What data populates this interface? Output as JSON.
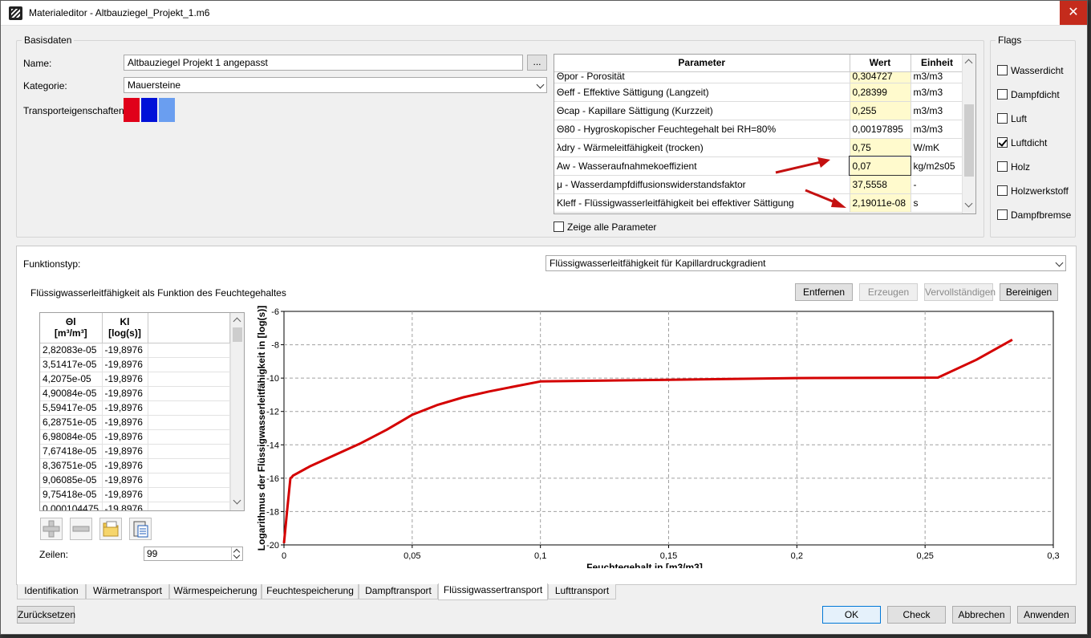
{
  "window": {
    "title": "Materialeditor - Altbauziegel_Projekt_1.m6",
    "close_label": "✕"
  },
  "basisdaten": {
    "group_title": "Basisdaten",
    "name_label": "Name:",
    "name_value": "Altbauziegel Projekt 1 angepasst",
    "browse_label": "...",
    "kategorie_label": "Kategorie:",
    "kategorie_value": "Mauersteine",
    "transport_label": "Transporteigenschaften:",
    "transport_colors": [
      "#e0001a",
      "#0010d8",
      "#6a9ef0"
    ]
  },
  "parameters": {
    "headers": [
      "Parameter",
      "Wert",
      "Einheit"
    ],
    "rows": [
      {
        "name": "Θpor - Porosität",
        "value": "0,304727",
        "unit": "m3/m3",
        "highlight": true
      },
      {
        "name": "Θeff - Effektive Sättigung (Langzeit)",
        "value": "0,28399",
        "unit": "m3/m3",
        "highlight": true
      },
      {
        "name": "Θcap - Kapillare Sättigung (Kurzzeit)",
        "value": "0,255",
        "unit": "m3/m3",
        "highlight": true
      },
      {
        "name": "Θ80 - Hygroskopischer Feuchtegehalt bei RH=80%",
        "value": "0,00197895",
        "unit": "m3/m3",
        "highlight": false
      },
      {
        "name": "λdry - Wärmeleitfähigkeit (trocken)",
        "value": "0,75",
        "unit": "W/mK",
        "highlight": true
      },
      {
        "name": "Aw - Wasseraufnahmekoeffizient",
        "value": "0,07",
        "unit": "kg/m2s05",
        "highlight": true
      },
      {
        "name": "μ - Wasserdampfdiffusionswiderstandsfaktor",
        "value": "37,5558",
        "unit": "-",
        "highlight": true
      },
      {
        "name": "Kleff - Flüssigwasserleitfähigkeit bei effektiver Sättigung",
        "value": "2,19011e-08",
        "unit": "s",
        "highlight": true
      }
    ],
    "show_all_label": "Zeige alle Parameter",
    "show_all_checked": false
  },
  "flags": {
    "group_title": "Flags",
    "items": [
      {
        "label": "Wasserdicht",
        "checked": false
      },
      {
        "label": "Dampfdicht",
        "checked": false
      },
      {
        "label": "Luft",
        "checked": false
      },
      {
        "label": "Luftdicht",
        "checked": true
      },
      {
        "label": "Holz",
        "checked": false
      },
      {
        "label": "Holzwerkstoff",
        "checked": false
      },
      {
        "label": "Dampfbremse",
        "checked": false
      }
    ]
  },
  "function": {
    "type_label": "Funktionstyp:",
    "type_value": "Flüssigwasserleitfähigkeit für Kapillardruckgradient",
    "description": "Flüssigwasserleitfähigkeit als Funktion des Feuchtegehaltes",
    "buttons": {
      "remove": "Entfernen",
      "create": "Erzeugen",
      "complete": "Vervollständigen",
      "clean": "Bereinigen"
    },
    "table_headers": {
      "col1_line1": "Θl",
      "col1_line2": "[m³/m³]",
      "col2_line1": "Kl",
      "col2_line2": "[log(s)]"
    },
    "table_rows": [
      [
        "2,82083e-05",
        "-19,8976"
      ],
      [
        "3,51417e-05",
        "-19,8976"
      ],
      [
        "4,2075e-05",
        "-19,8976"
      ],
      [
        "4,90084e-05",
        "-19,8976"
      ],
      [
        "5,59417e-05",
        "-19,8976"
      ],
      [
        "6,28751e-05",
        "-19,8976"
      ],
      [
        "6,98084e-05",
        "-19,8976"
      ],
      [
        "7,67418e-05",
        "-19,8976"
      ],
      [
        "8,36751e-05",
        "-19,8976"
      ],
      [
        "9,06085e-05",
        "-19,8976"
      ],
      [
        "9,75418e-05",
        "-19,8976"
      ],
      [
        "0,000104475",
        "-19,8976"
      ]
    ],
    "rows_label": "Zeilen:",
    "rows_value": "99"
  },
  "chart_data": {
    "type": "line",
    "xlabel": "Feuchtegehalt in [m3/m3]",
    "ylabel": "Logarithmus der Flüssigwasserleitfähigkeit in [log(s)]",
    "xlim": [
      0,
      0.3
    ],
    "ylim": [
      -20,
      -6
    ],
    "xticks": [
      "0",
      "0,05",
      "0,1",
      "0,15",
      "0,2",
      "0,25",
      "0,3"
    ],
    "yticks": [
      "-6",
      "-8",
      "-10",
      "-12",
      "-14",
      "-16",
      "-18",
      "-20"
    ],
    "grid": true,
    "line_color": "#d40000",
    "series": [
      {
        "x": [
          0.0,
          0.0012,
          0.0025,
          0.003,
          0.0035,
          0.01,
          0.02,
          0.03,
          0.04,
          0.05,
          0.06,
          0.07,
          0.08,
          0.09,
          0.1,
          0.15,
          0.2,
          0.255,
          0.27,
          0.284
        ],
        "y": [
          -19.9,
          -18.0,
          -16.0,
          -15.95,
          -15.85,
          -15.3,
          -14.6,
          -13.9,
          -13.1,
          -12.2,
          -11.6,
          -11.15,
          -10.8,
          -10.5,
          -10.2,
          -10.1,
          -10.0,
          -9.97,
          -8.9,
          -7.7
        ]
      }
    ]
  },
  "tabs": [
    {
      "label": "Identifikation",
      "active": false
    },
    {
      "label": "Wärmetransport",
      "active": false
    },
    {
      "label": "Wärmespeicherung",
      "active": false
    },
    {
      "label": "Feuchtespeicherung",
      "active": false
    },
    {
      "label": "Dampftransport",
      "active": false
    },
    {
      "label": "Flüssigwassertransport",
      "active": true
    },
    {
      "label": "Lufttransport",
      "active": false
    }
  ],
  "footer": {
    "reset": "Zurücksetzen",
    "ok": "OK",
    "check": "Check",
    "cancel": "Abbrechen",
    "apply": "Anwenden"
  }
}
